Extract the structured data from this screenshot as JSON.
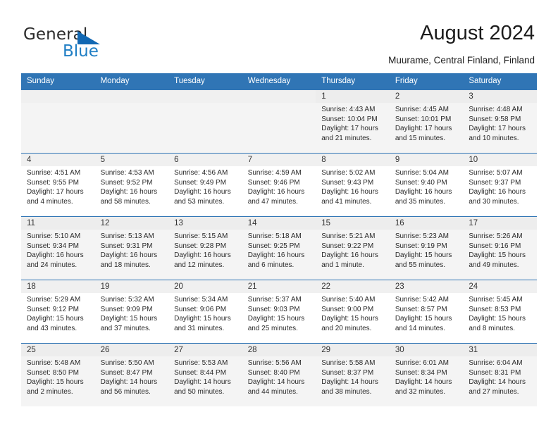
{
  "logo": {
    "word_top": "General",
    "word_bottom": "Blue",
    "triangle_color": "#1268b3",
    "blue_color": "#1f7ec4"
  },
  "header": {
    "title": "August 2024",
    "subtitle": "Muurame, Central Finland, Finland"
  },
  "theme": {
    "header_blue": "#3075b5",
    "row_shade": "#f4f4f4",
    "daynum_band": "#f0f0f0"
  },
  "weekday_headers": [
    "Sunday",
    "Monday",
    "Tuesday",
    "Wednesday",
    "Thursday",
    "Friday",
    "Saturday"
  ],
  "weeks": [
    [
      {
        "day": "",
        "sunrise": "",
        "sunset": "",
        "daylight": ""
      },
      {
        "day": "",
        "sunrise": "",
        "sunset": "",
        "daylight": ""
      },
      {
        "day": "",
        "sunrise": "",
        "sunset": "",
        "daylight": ""
      },
      {
        "day": "",
        "sunrise": "",
        "sunset": "",
        "daylight": ""
      },
      {
        "day": "1",
        "sunrise": "Sunrise: 4:43 AM",
        "sunset": "Sunset: 10:04 PM",
        "daylight": "Daylight: 17 hours and 21 minutes."
      },
      {
        "day": "2",
        "sunrise": "Sunrise: 4:45 AM",
        "sunset": "Sunset: 10:01 PM",
        "daylight": "Daylight: 17 hours and 15 minutes."
      },
      {
        "day": "3",
        "sunrise": "Sunrise: 4:48 AM",
        "sunset": "Sunset: 9:58 PM",
        "daylight": "Daylight: 17 hours and 10 minutes."
      }
    ],
    [
      {
        "day": "4",
        "sunrise": "Sunrise: 4:51 AM",
        "sunset": "Sunset: 9:55 PM",
        "daylight": "Daylight: 17 hours and 4 minutes."
      },
      {
        "day": "5",
        "sunrise": "Sunrise: 4:53 AM",
        "sunset": "Sunset: 9:52 PM",
        "daylight": "Daylight: 16 hours and 58 minutes."
      },
      {
        "day": "6",
        "sunrise": "Sunrise: 4:56 AM",
        "sunset": "Sunset: 9:49 PM",
        "daylight": "Daylight: 16 hours and 53 minutes."
      },
      {
        "day": "7",
        "sunrise": "Sunrise: 4:59 AM",
        "sunset": "Sunset: 9:46 PM",
        "daylight": "Daylight: 16 hours and 47 minutes."
      },
      {
        "day": "8",
        "sunrise": "Sunrise: 5:02 AM",
        "sunset": "Sunset: 9:43 PM",
        "daylight": "Daylight: 16 hours and 41 minutes."
      },
      {
        "day": "9",
        "sunrise": "Sunrise: 5:04 AM",
        "sunset": "Sunset: 9:40 PM",
        "daylight": "Daylight: 16 hours and 35 minutes."
      },
      {
        "day": "10",
        "sunrise": "Sunrise: 5:07 AM",
        "sunset": "Sunset: 9:37 PM",
        "daylight": "Daylight: 16 hours and 30 minutes."
      }
    ],
    [
      {
        "day": "11",
        "sunrise": "Sunrise: 5:10 AM",
        "sunset": "Sunset: 9:34 PM",
        "daylight": "Daylight: 16 hours and 24 minutes."
      },
      {
        "day": "12",
        "sunrise": "Sunrise: 5:13 AM",
        "sunset": "Sunset: 9:31 PM",
        "daylight": "Daylight: 16 hours and 18 minutes."
      },
      {
        "day": "13",
        "sunrise": "Sunrise: 5:15 AM",
        "sunset": "Sunset: 9:28 PM",
        "daylight": "Daylight: 16 hours and 12 minutes."
      },
      {
        "day": "14",
        "sunrise": "Sunrise: 5:18 AM",
        "sunset": "Sunset: 9:25 PM",
        "daylight": "Daylight: 16 hours and 6 minutes."
      },
      {
        "day": "15",
        "sunrise": "Sunrise: 5:21 AM",
        "sunset": "Sunset: 9:22 PM",
        "daylight": "Daylight: 16 hours and 1 minute."
      },
      {
        "day": "16",
        "sunrise": "Sunrise: 5:23 AM",
        "sunset": "Sunset: 9:19 PM",
        "daylight": "Daylight: 15 hours and 55 minutes."
      },
      {
        "day": "17",
        "sunrise": "Sunrise: 5:26 AM",
        "sunset": "Sunset: 9:16 PM",
        "daylight": "Daylight: 15 hours and 49 minutes."
      }
    ],
    [
      {
        "day": "18",
        "sunrise": "Sunrise: 5:29 AM",
        "sunset": "Sunset: 9:12 PM",
        "daylight": "Daylight: 15 hours and 43 minutes."
      },
      {
        "day": "19",
        "sunrise": "Sunrise: 5:32 AM",
        "sunset": "Sunset: 9:09 PM",
        "daylight": "Daylight: 15 hours and 37 minutes."
      },
      {
        "day": "20",
        "sunrise": "Sunrise: 5:34 AM",
        "sunset": "Sunset: 9:06 PM",
        "daylight": "Daylight: 15 hours and 31 minutes."
      },
      {
        "day": "21",
        "sunrise": "Sunrise: 5:37 AM",
        "sunset": "Sunset: 9:03 PM",
        "daylight": "Daylight: 15 hours and 25 minutes."
      },
      {
        "day": "22",
        "sunrise": "Sunrise: 5:40 AM",
        "sunset": "Sunset: 9:00 PM",
        "daylight": "Daylight: 15 hours and 20 minutes."
      },
      {
        "day": "23",
        "sunrise": "Sunrise: 5:42 AM",
        "sunset": "Sunset: 8:57 PM",
        "daylight": "Daylight: 15 hours and 14 minutes."
      },
      {
        "day": "24",
        "sunrise": "Sunrise: 5:45 AM",
        "sunset": "Sunset: 8:53 PM",
        "daylight": "Daylight: 15 hours and 8 minutes."
      }
    ],
    [
      {
        "day": "25",
        "sunrise": "Sunrise: 5:48 AM",
        "sunset": "Sunset: 8:50 PM",
        "daylight": "Daylight: 15 hours and 2 minutes."
      },
      {
        "day": "26",
        "sunrise": "Sunrise: 5:50 AM",
        "sunset": "Sunset: 8:47 PM",
        "daylight": "Daylight: 14 hours and 56 minutes."
      },
      {
        "day": "27",
        "sunrise": "Sunrise: 5:53 AM",
        "sunset": "Sunset: 8:44 PM",
        "daylight": "Daylight: 14 hours and 50 minutes."
      },
      {
        "day": "28",
        "sunrise": "Sunrise: 5:56 AM",
        "sunset": "Sunset: 8:40 PM",
        "daylight": "Daylight: 14 hours and 44 minutes."
      },
      {
        "day": "29",
        "sunrise": "Sunrise: 5:58 AM",
        "sunset": "Sunset: 8:37 PM",
        "daylight": "Daylight: 14 hours and 38 minutes."
      },
      {
        "day": "30",
        "sunrise": "Sunrise: 6:01 AM",
        "sunset": "Sunset: 8:34 PM",
        "daylight": "Daylight: 14 hours and 32 minutes."
      },
      {
        "day": "31",
        "sunrise": "Sunrise: 6:04 AM",
        "sunset": "Sunset: 8:31 PM",
        "daylight": "Daylight: 14 hours and 27 minutes."
      }
    ]
  ]
}
